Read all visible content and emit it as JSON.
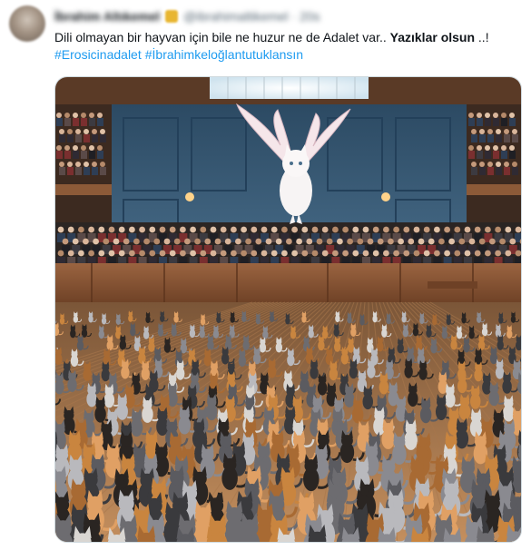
{
  "author": {
    "display_name": "İbrahim Altıkemel",
    "handle": "@ibrahimaltikemel · 20s",
    "avatar_icon": "user-avatar-icon",
    "verified_badge_color": "#e8b631"
  },
  "tweet": {
    "text_plain": "Dili olmayan bir hayvan için bile ne huzur ne de Adalet var.. ",
    "text_bold": "Yazıklar olsun",
    "text_tail": " ..!",
    "hashtags": [
      "#Erosicinadalet",
      "#İbrahimkeloğlantutuklansın"
    ]
  },
  "media": {
    "image_icon": "courtroom-cats-image",
    "colors": {
      "link": "#1d9bf0",
      "wood": "#8a5a3b",
      "wall": "#3b5f7a"
    }
  }
}
